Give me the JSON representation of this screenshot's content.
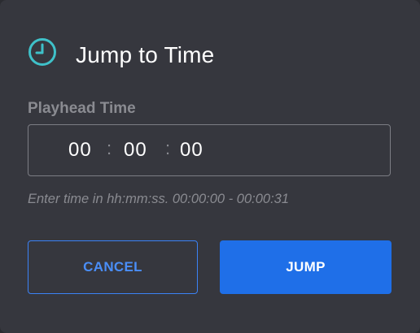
{
  "dialog": {
    "title": "Jump to Time",
    "icon": "clock-icon",
    "accent_color": "#3fc1c9"
  },
  "field": {
    "label": "Playhead Time",
    "hours": "00",
    "minutes": "00",
    "seconds": "00",
    "separator": ":",
    "hint": "Enter time in hh:mm:ss. 00:00:00 - 00:00:31"
  },
  "buttons": {
    "cancel_label": "CANCEL",
    "jump_label": "JUMP",
    "primary_color": "#1f6fe8"
  }
}
